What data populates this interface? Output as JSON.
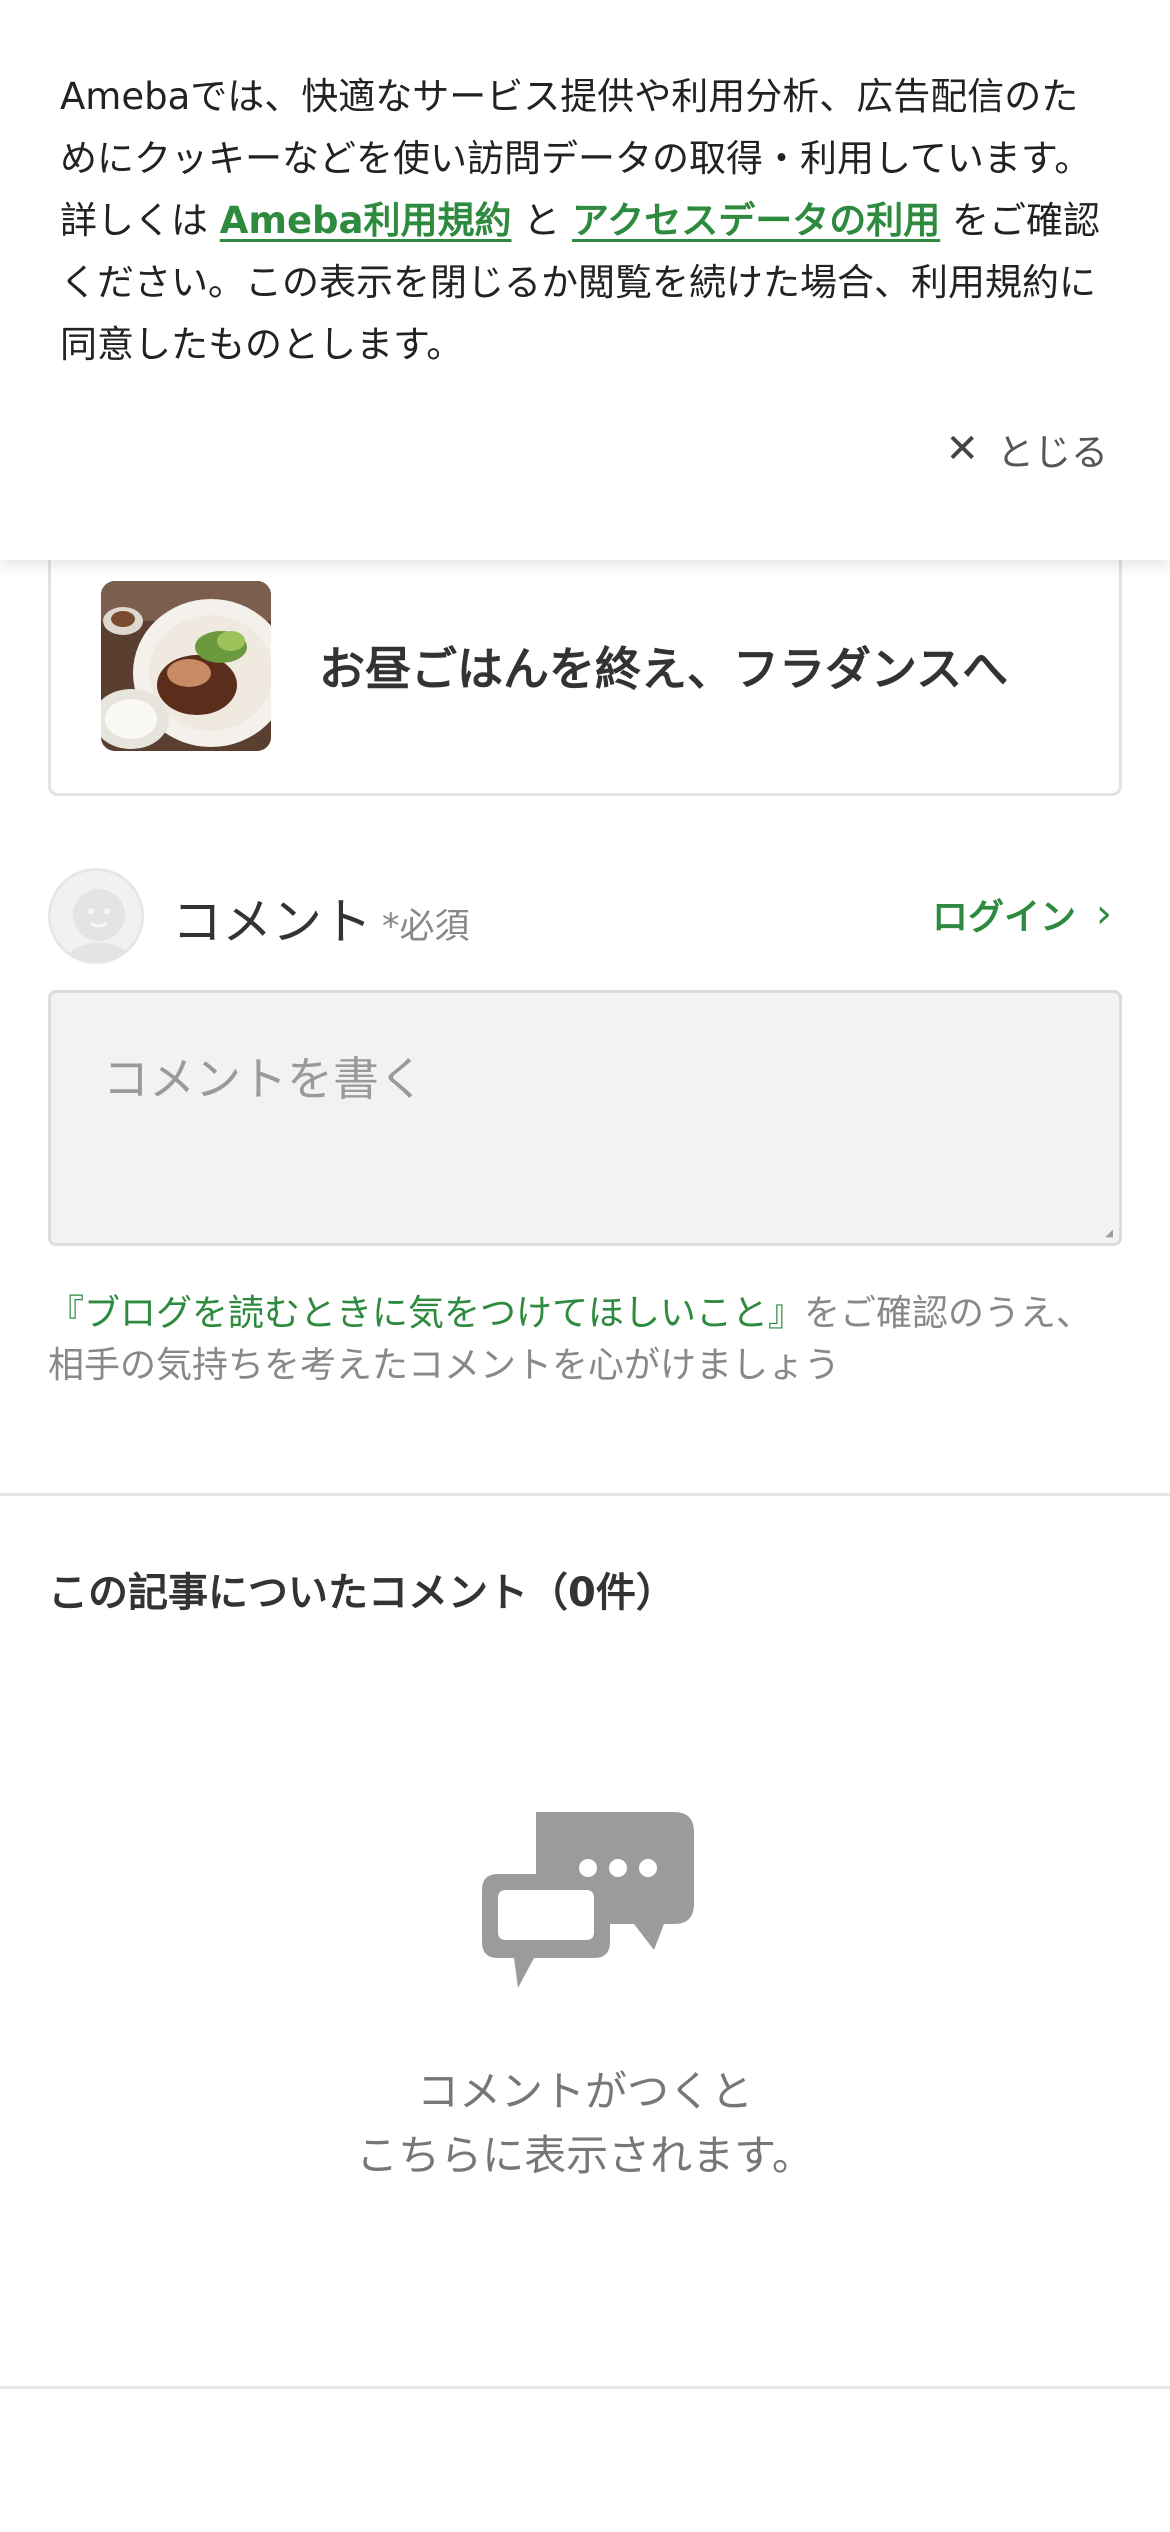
{
  "cookie_banner": {
    "text_1": "Amebaでは、快適なサービス提供や利用分析、広告配信のためにクッキーなどを使い訪問データの取得・利用しています。詳しくは ",
    "link_terms": "Ameba利用規約",
    "text_2": " と ",
    "link_access": "アクセスデータの利用",
    "text_3": " をご確認ください。この表示を閉じるか閲覧を続けた場合、利用規約に同意したものとします。",
    "close_label": "とじる",
    "close_icon": "close-icon"
  },
  "article_card": {
    "title": "お昼ごはんを終え、フラダンスへ"
  },
  "comment": {
    "label": "コメント",
    "required": "*必須",
    "login": "ログイン",
    "placeholder": "コメントを書く",
    "guideline_link": "『ブログを読むときに気をつけてほしいこと』",
    "guideline_text": "をご確認のうえ、相手の気持ちを考えたコメントを心がけましょう"
  },
  "comments_section": {
    "title": "この記事についたコメント（0件）",
    "empty_line_1": "コメントがつくと",
    "empty_line_2": "こちらに表示されます。"
  },
  "colors": {
    "accent_green": "#2d8a3e",
    "text_primary": "#333333",
    "text_muted": "#888888"
  }
}
